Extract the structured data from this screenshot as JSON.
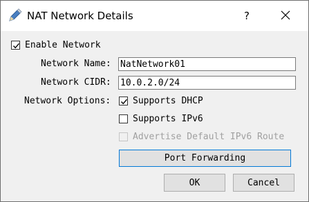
{
  "window": {
    "title": "NAT Network Details",
    "help_label": "?"
  },
  "icons": {
    "app": "pencil-edit-icon",
    "close": "close-icon"
  },
  "form": {
    "enable_network": {
      "label": "Enable Network",
      "checked": true
    },
    "network_name": {
      "label": "Network Name:",
      "value": "NatNetwork01"
    },
    "network_cidr": {
      "label": "Network CIDR:",
      "value": "10.0.2.0/24"
    },
    "network_options_label": "Network Options:",
    "supports_dhcp": {
      "label": "Supports DHCP",
      "checked": true
    },
    "supports_ipv6": {
      "label": "Supports IPv6",
      "checked": false
    },
    "advertise_ipv6": {
      "label": "Advertise Default IPv6 Route",
      "checked": false,
      "enabled": false
    }
  },
  "buttons": {
    "port_forwarding": "Port Forwarding",
    "ok": "OK",
    "cancel": "Cancel"
  },
  "colors": {
    "accent": "#0078d7",
    "dialog_bg": "#f0f0f0",
    "disabled_text": "#a0a0a0"
  }
}
